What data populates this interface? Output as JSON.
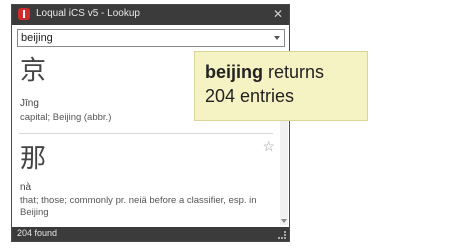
{
  "window": {
    "title": "Loqual iCS v5 - Lookup",
    "close_glyph": "✕"
  },
  "search": {
    "value": "beijing"
  },
  "results": [
    {
      "hanzi": "京",
      "pinyin": "Jīng",
      "definition": "capital; Beijing (abbr.)"
    },
    {
      "hanzi": "那",
      "pinyin": "nà",
      "definition": "that; those; commonly pr. neiä before a classifier, esp. in Beijing",
      "star_glyph": "☆"
    }
  ],
  "status": {
    "text": "204 found"
  },
  "callout": {
    "bold": "beijing",
    "rest": " returns 204 entries"
  }
}
